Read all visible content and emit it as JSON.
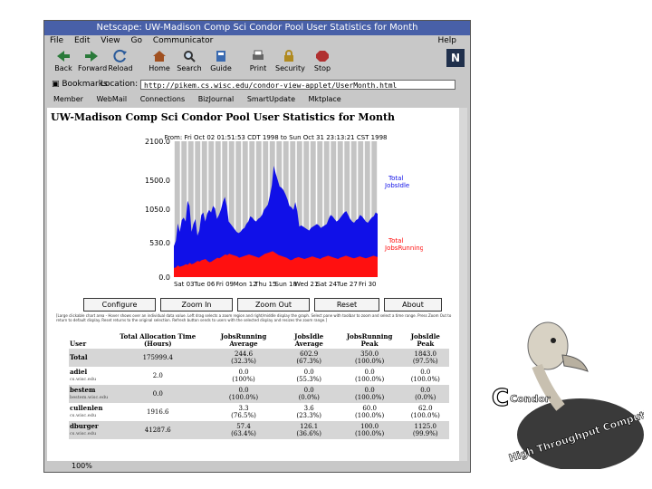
{
  "window": {
    "title": "Netscape: UW-Madison Comp Sci Condor Pool User Statistics for Month",
    "menu": [
      "File",
      "Edit",
      "View",
      "Go",
      "Communicator"
    ],
    "help": "Help",
    "toolbar": [
      "Back",
      "Forward",
      "Reload",
      "Home",
      "Search",
      "Guide",
      "Print",
      "Security",
      "Stop"
    ],
    "location_label": "Location:",
    "bookmarks_label": "Bookmarks",
    "url": "http://pikem.cs.wisc.edu/condor-view-applet/UserMonth.html",
    "bookmarks": [
      "Member",
      "WebMail",
      "Connections",
      "BizJournal",
      "SmartUpdate",
      "Mktplace"
    ],
    "status_pct": "100%"
  },
  "page": {
    "title": "UW-Madison Comp Sci Condor Pool User Statistics for Month",
    "controls": [
      "Configure",
      "Zoom In",
      "Zoom Out",
      "Reset",
      "About"
    ],
    "note": "[Large clickable chart area - Hover shows over an individual data value. Left drag selects a zoom region and right/middle display the graph. Select pane with toolbar to zoom and select a time range. Press Zoom Out to return to default display. Reset returns to the original selection. Refresh button sends to users with the selected display and resizes the zoom range.]"
  },
  "chart_data": {
    "type": "area",
    "subtitle": "From: Fri Oct 02 01:51:53 CDT 1998 to Sun Oct 31 23:13:21 CST 1998",
    "x_ticks": [
      "Sat 03",
      "Tue 06",
      "Fri 09",
      "Mon 12",
      "Thu 15",
      "Sun 18",
      "Wed 21",
      "Sat 24",
      "Tue 27",
      "Fri 30"
    ],
    "y_ticks": [
      "2100.0",
      "1500.0",
      "1050.0",
      "530.0",
      "0.0"
    ],
    "ylim": [
      0,
      2100
    ],
    "series": [
      {
        "name": "Total JobsIdle",
        "color": "#1010e8",
        "values": [
          480,
          560,
          830,
          700,
          880,
          920,
          860,
          1180,
          1100,
          700,
          820,
          900,
          640,
          720,
          960,
          1000,
          860,
          980,
          1040,
          1000,
          1100,
          1060,
          900,
          960,
          1040,
          1160,
          1240,
          1100,
          860,
          820,
          780,
          740,
          700,
          680,
          700,
          740,
          760,
          820,
          860,
          940,
          920,
          880,
          860,
          900,
          920,
          960,
          1040,
          1080,
          1120,
          1260,
          1420,
          1720,
          1600,
          1500,
          1400,
          1380,
          1340,
          1280,
          1200,
          1100,
          1080,
          1040,
          1160,
          1020,
          780,
          800,
          780,
          760,
          740,
          720,
          760,
          780,
          800,
          820,
          800,
          760,
          780,
          800,
          820,
          900,
          960,
          940,
          900,
          860,
          880,
          920,
          960,
          1000,
          1020,
          960,
          900,
          860,
          840,
          880,
          900,
          960,
          940,
          900,
          860,
          840,
          880,
          920,
          940,
          1000,
          980
        ]
      },
      {
        "name": "Total JobsRunning",
        "color": "#ff1010",
        "values": [
          140,
          150,
          180,
          160,
          170,
          180,
          200,
          190,
          220,
          200,
          210,
          230,
          250,
          240,
          260,
          270,
          280,
          250,
          230,
          240,
          260,
          280,
          300,
          290,
          310,
          330,
          350,
          340,
          360,
          350,
          340,
          330,
          320,
          300,
          310,
          320,
          330,
          340,
          350,
          340,
          330,
          320,
          310,
          300,
          320,
          340,
          360,
          370,
          380,
          390,
          400,
          380,
          360,
          340,
          330,
          320,
          310,
          300,
          280,
          260,
          270,
          290,
          300,
          310,
          300,
          290,
          280,
          290,
          300,
          310,
          320,
          310,
          300,
          290,
          280,
          300,
          310,
          320,
          330,
          320,
          310,
          300,
          290,
          280,
          300,
          310,
          320,
          330,
          320,
          310,
          300,
          290,
          300,
          310,
          320,
          310,
          300,
          290,
          300,
          310,
          320,
          330,
          320,
          310
        ]
      }
    ],
    "legend": [
      {
        "line1": "Total",
        "line2": "JobsIdle",
        "color": "#1010e8"
      },
      {
        "line1": "Total",
        "line2": "JobsRunning",
        "color": "#ff1010"
      }
    ]
  },
  "table": {
    "headers": [
      "User",
      "Total Allocation Time (Hours)",
      "JobsRunning Average",
      "JobsIdle Average",
      "JobsRunning Peak",
      "JobsIdle Peak"
    ],
    "rows": [
      {
        "user": "Total",
        "sub": "",
        "cells": [
          "175999.4",
          "244.6 (32.3%)",
          "602.9 (67.3%)",
          "350.0 (100.0%)",
          "1843.0 (97.5%)"
        ],
        "shade": true
      },
      {
        "user": "adiel",
        "sub": "cs.wisc.edu",
        "cells": [
          "2.0",
          "0.0 (100%)",
          "0.0 (55.3%)",
          "0.0 (100.0%)",
          "0.0 (100.0%)"
        ],
        "shade": false
      },
      {
        "user": "bestem",
        "sub": "bestem.wisc.edu",
        "cells": [
          "0.0",
          "0.0 (100.0%)",
          "0.0 (0.0%)",
          "0.0 (100.0%)",
          "0.0 (0.0%)"
        ],
        "shade": true
      },
      {
        "user": "cullenlen",
        "sub": "cs.wisc.edu",
        "cells": [
          "1916.6",
          "3.3 (76.5%)",
          "3.6 (23.3%)",
          "60.0 (100.0%)",
          "62.0 (100.0%)"
        ],
        "shade": false
      },
      {
        "user": "dburger",
        "sub": "cs.wisc.edu",
        "cells": [
          "41287.6",
          "57.4 (63.4%)",
          "126.1 (36.6%)",
          "100.0 (100.0%)",
          "1125.0 (99.9%)"
        ],
        "shade": true
      }
    ]
  },
  "condor_logo": {
    "wordmark": "Condor",
    "tagline": "High Throughput Computing"
  }
}
